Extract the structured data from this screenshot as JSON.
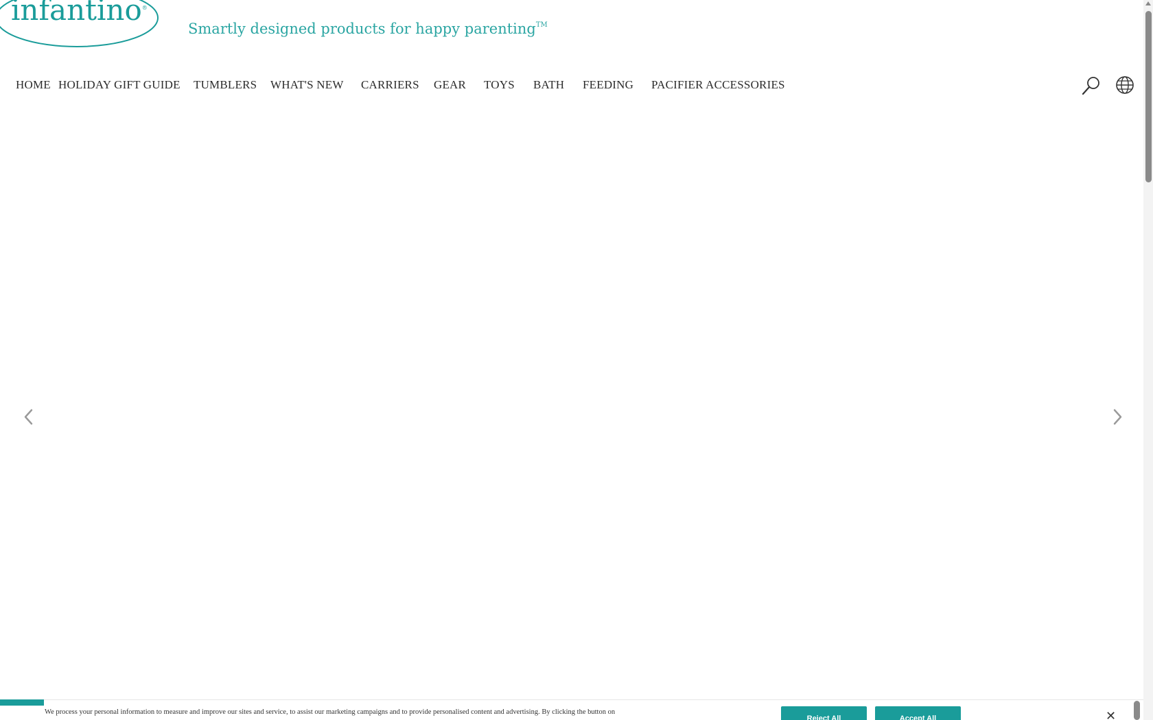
{
  "brand": {
    "logo_text": "infantino",
    "logo_reg": "®",
    "tagline": "Smartly designed products for happy parenting",
    "tagline_tm": "TM",
    "color": "#1a9c9a"
  },
  "nav": {
    "items": [
      {
        "label": "HOME"
      },
      {
        "label": "HOLIDAY GIFT GUIDE"
      },
      {
        "label": "TUMBLERS"
      },
      {
        "label": "WHAT'S NEW"
      },
      {
        "label": "CARRIERS"
      },
      {
        "label": "GEAR"
      },
      {
        "label": "TOYS"
      },
      {
        "label": "BATH"
      },
      {
        "label": "FEEDING"
      },
      {
        "label": "PACIFIER ACCESSORIES"
      }
    ]
  },
  "header_icons": {
    "search": "search-icon",
    "language": "globe-icon"
  },
  "carousel": {
    "prev_icon": "chevron-left-icon",
    "next_icon": "chevron-right-icon"
  },
  "cookie_banner": {
    "text": "We process your personal information to measure and improve our sites and service, to assist our marketing campaigns and to provide personalised content and advertising. By clicking the button on",
    "reject_label": "Reject All",
    "accept_label": "Accept All",
    "close_label": "✕"
  }
}
